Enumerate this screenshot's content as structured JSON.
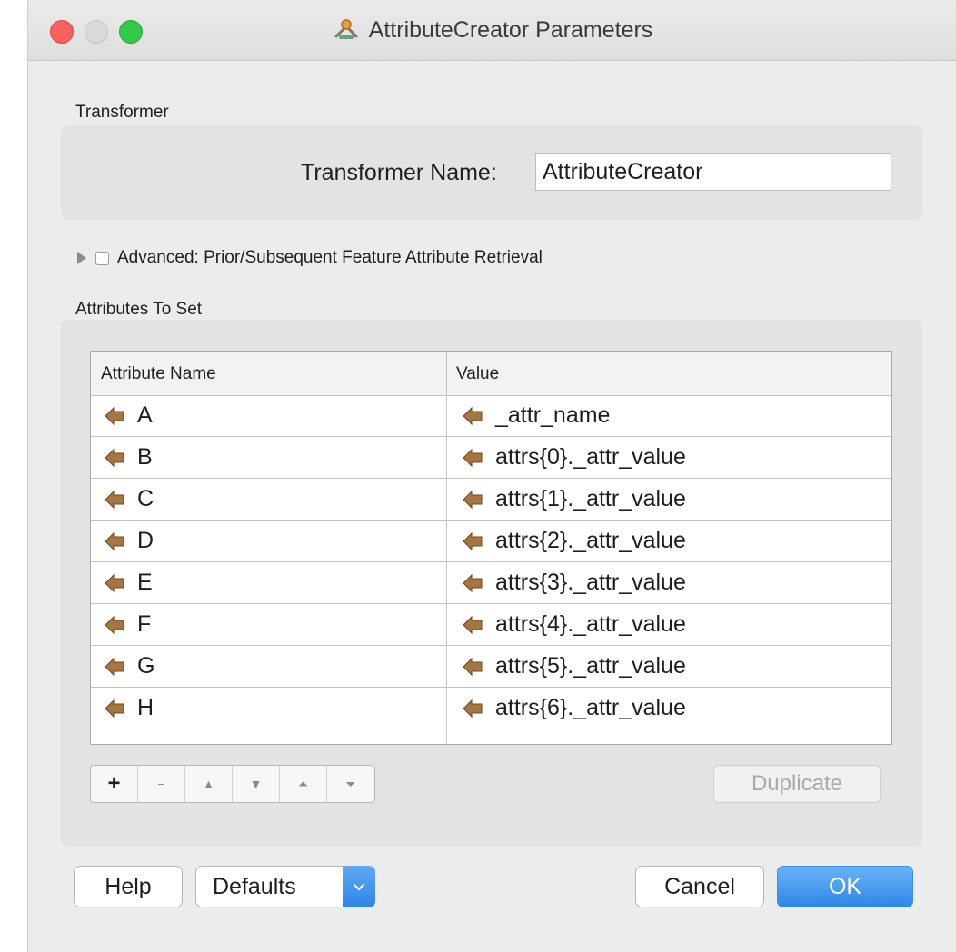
{
  "window": {
    "title": "AttributeCreator Parameters"
  },
  "transformer": {
    "section_label": "Transformer",
    "name_label": "Transformer Name:",
    "name_value": "AttributeCreator"
  },
  "advanced": {
    "label": "Advanced: Prior/Subsequent Feature Attribute Retrieval",
    "checked": false,
    "expanded": false
  },
  "attributes": {
    "section_label": "Attributes To Set",
    "columns": [
      "Attribute Name",
      "Value"
    ],
    "rows": [
      {
        "name": "A",
        "value": "_attr_name"
      },
      {
        "name": "B",
        "value": "attrs{0}._attr_value"
      },
      {
        "name": "C",
        "value": "attrs{1}._attr_value"
      },
      {
        "name": "D",
        "value": "attrs{2}._attr_value"
      },
      {
        "name": "E",
        "value": "attrs{3}._attr_value"
      },
      {
        "name": "F",
        "value": "attrs{4}._attr_value"
      },
      {
        "name": "G",
        "value": "attrs{5}._attr_value"
      },
      {
        "name": "H",
        "value": "attrs{6}._attr_value"
      }
    ],
    "toolbar": {
      "add": "+",
      "remove": "−",
      "move_up": "▲",
      "move_down": "▼",
      "move_top": "⏶",
      "move_bottom": "⏷"
    },
    "duplicate_label": "Duplicate"
  },
  "footer": {
    "help_label": "Help",
    "defaults_label": "Defaults",
    "cancel_label": "Cancel",
    "ok_label": "OK"
  },
  "colors": {
    "accent": "#2f86e8",
    "attribute_icon": "#a7753f",
    "close": "#fc605c",
    "maximize": "#34c84a"
  },
  "icons": {
    "title": "transformer-icon",
    "attribute": "attribute-arrow-icon",
    "dropdown": "chevron-down-icon"
  }
}
